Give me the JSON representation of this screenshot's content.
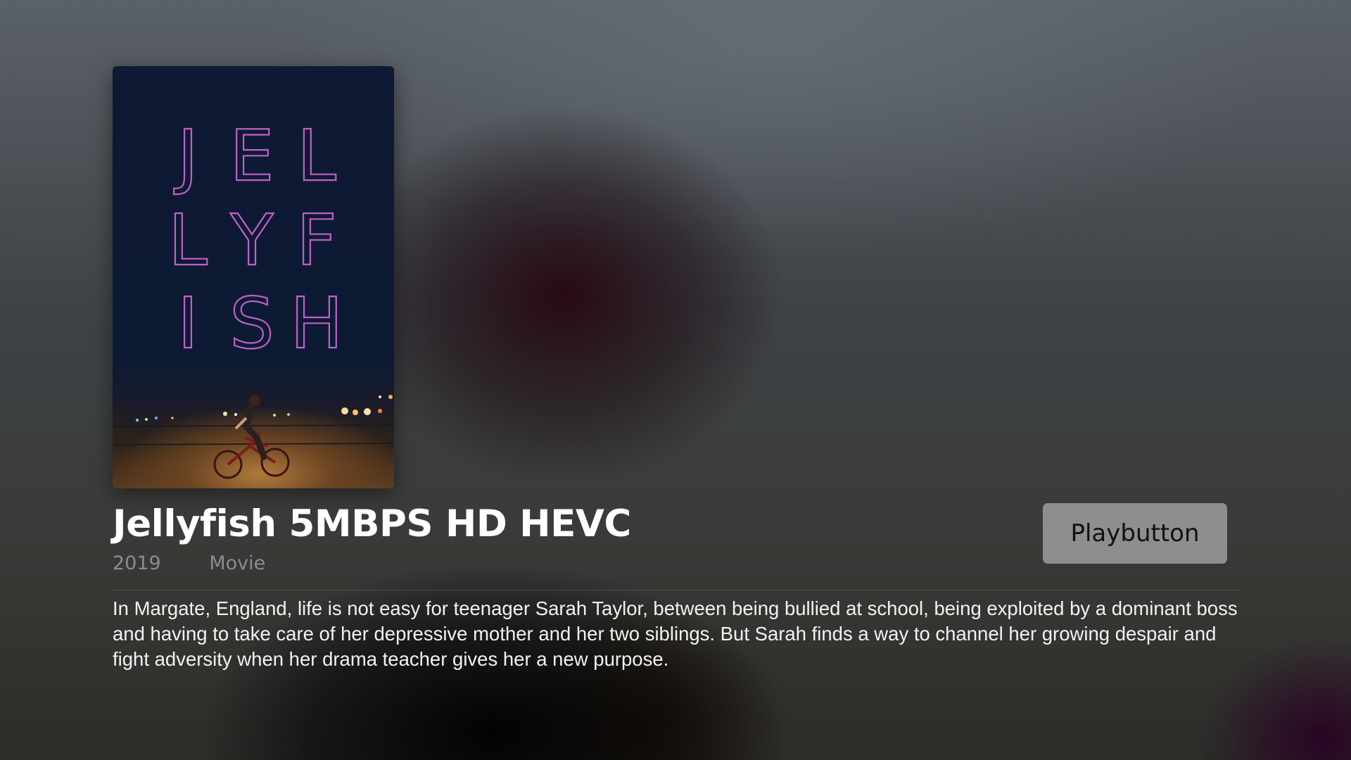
{
  "poster": {
    "letters": [
      [
        "J",
        "E",
        "L"
      ],
      [
        "L",
        "Y",
        "F"
      ],
      [
        "I",
        "S",
        "H"
      ]
    ],
    "letter_color": "#c060c8"
  },
  "detail": {
    "title": "Jellyfish 5MBPS HD HEVC",
    "year": "2019",
    "type": "Movie",
    "description": "In Margate, England, life is not easy for teenager Sarah Taylor, between being bullied at school, being exploited by a dominant boss and having to take care of her depressive mother and her two siblings. But Sarah finds a way to channel her growing despair and fight adversity when her drama teacher gives her a new purpose."
  },
  "actions": {
    "play_label": "Playbutton"
  }
}
